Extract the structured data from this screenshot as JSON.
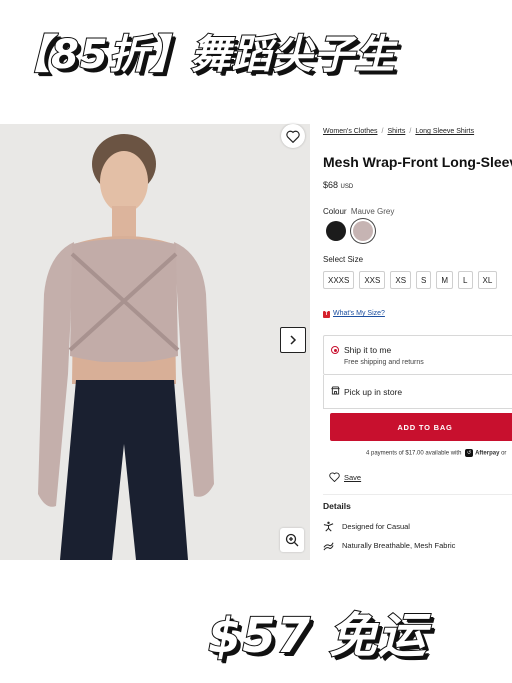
{
  "promo": {
    "top": "【85折】舞蹈尖子生",
    "bottom": "$57 免运"
  },
  "breadcrumb": {
    "items": [
      "Women's Clothes",
      "Shirts",
      "Long Sleeve Shirts"
    ],
    "separator": "/"
  },
  "product": {
    "title": "Mesh Wrap-Front Long-Sleeve Shirt",
    "price": "$68",
    "currency": "USD"
  },
  "colour": {
    "label": "Colour",
    "selected": "Mauve Grey",
    "swatches": [
      {
        "name": "Black",
        "hex": "#1b1b1b"
      },
      {
        "name": "Mauve Grey",
        "hex": "#c6b4b3"
      }
    ]
  },
  "size": {
    "label": "Select Size",
    "options": [
      "XXXS",
      "XXS",
      "XS",
      "S",
      "M",
      "L",
      "XL"
    ]
  },
  "size_guide": {
    "badge": "T",
    "label": "What's My Size?"
  },
  "shipping": {
    "option_title": "Ship it to me",
    "option_sub": "Free shipping and returns",
    "pickup_label": "Pick up in store"
  },
  "cta": {
    "add_to_bag": "ADD TO BAG"
  },
  "afterpay": {
    "prefix": "4 payments of ",
    "amount": "$17.00",
    "middle": " available with ",
    "brand": "Afterpay",
    "suffix": " or"
  },
  "save": {
    "label": "Save"
  },
  "details": {
    "heading": "Details",
    "features": [
      "Designed for Casual",
      "Naturally Breathable, Mesh Fabric"
    ]
  },
  "icons": {
    "wishlist": "heart-icon",
    "next": "chevron-right-icon",
    "zoom": "zoom-in-icon",
    "store": "store-icon",
    "activity": "activity-icon",
    "fabric": "fabric-icon"
  },
  "colors": {
    "accent_red": "#c8102e",
    "garment": "#c2aca8",
    "leggings": "#1a2030",
    "photo_bg": "#e9e8e6"
  }
}
